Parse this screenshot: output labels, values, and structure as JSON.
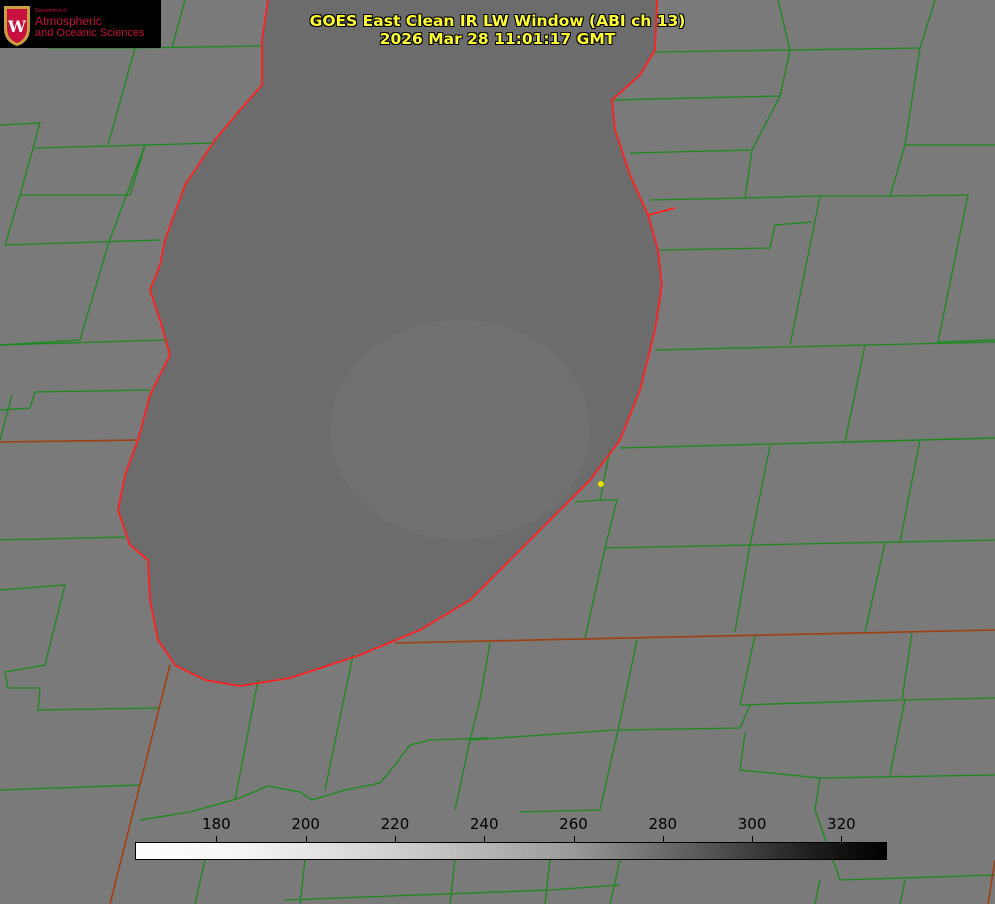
{
  "title": {
    "line1": "GOES East Clean IR LW Window (ABI ch 13)",
    "line2": "2026 Mar 28 11:01:17 GMT"
  },
  "logo": {
    "letter": "W",
    "dept": "Department of",
    "name_line1": "Atmospheric",
    "name_line2": "and Oceanic Sciences"
  },
  "colorbar": {
    "min": 162,
    "max": 330,
    "ticks": [
      "180",
      "200",
      "220",
      "240",
      "260",
      "280",
      "300",
      "320"
    ],
    "tick_values": [
      180,
      200,
      220,
      240,
      260,
      280,
      300,
      320
    ]
  },
  "colors": {
    "county_lines": "#1a8a1a",
    "shoreline": "#ff2020",
    "state_lines": "#a04010",
    "marker": "#e8e000",
    "title_text": "#ffff33"
  }
}
